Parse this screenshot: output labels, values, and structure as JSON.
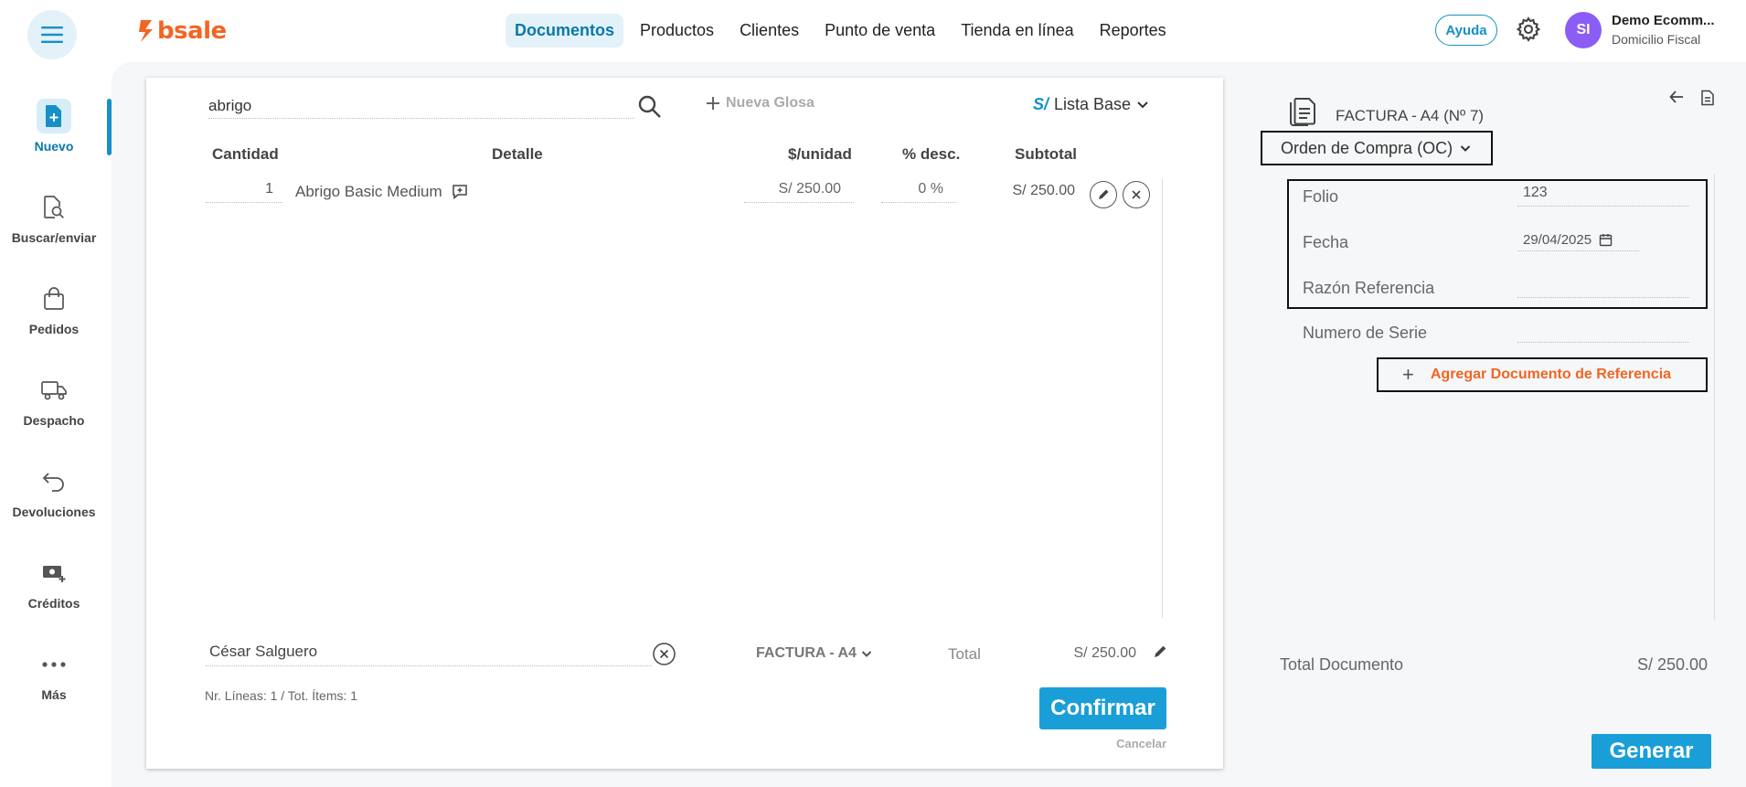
{
  "brand": {
    "logo_text": "bsale",
    "color": "#f26522"
  },
  "nav": {
    "items": [
      {
        "label": "Documentos",
        "active": true
      },
      {
        "label": "Productos"
      },
      {
        "label": "Clientes"
      },
      {
        "label": "Punto de venta"
      },
      {
        "label": "Tienda en línea"
      },
      {
        "label": "Reportes"
      }
    ],
    "help_label": "Ayuda",
    "avatar_initials": "SI",
    "account_name": "Demo Ecomm...",
    "account_subtitle": "Domicilio Fiscal"
  },
  "sidebar": {
    "items": [
      {
        "label": "Nuevo",
        "icon": "new-document-icon",
        "active": true
      },
      {
        "label": "Buscar/enviar",
        "icon": "search-document-icon"
      },
      {
        "label": "Pedidos",
        "icon": "shopping-bag-icon"
      },
      {
        "label": "Despacho",
        "icon": "truck-icon"
      },
      {
        "label": "Devoluciones",
        "icon": "return-arrow-icon"
      },
      {
        "label": "Créditos",
        "icon": "money-add-icon"
      },
      {
        "label": "Más",
        "icon": "more-dots-icon"
      }
    ]
  },
  "editor": {
    "search_value": "abrigo",
    "nueva_glosa": "Nueva Glosa",
    "price_list": {
      "currency": "S/",
      "label": "Lista Base"
    },
    "columns": {
      "cantidad": "Cantidad",
      "detalle": "Detalle",
      "unidad": "$/unidad",
      "desc": "% desc.",
      "subtotal": "Subtotal"
    },
    "line": {
      "qty": "1",
      "detail": "Abrigo Basic Medium",
      "unit_price": "S/ 250.00",
      "discount": "0 %",
      "subtotal": "S/ 250.00"
    },
    "client": "César Salguero",
    "doc_type": "FACTURA - A4",
    "total_label": "Total",
    "total_value": "S/ 250.00",
    "lines_info": "Nr. Líneas: 1 / Tot. Ítems: 1",
    "confirm_label": "Confirmar",
    "cancel_label": "Cancelar"
  },
  "right_panel": {
    "doc_title": "FACTURA - A4 (Nº 7)",
    "reference_type": "Orden de Compra (OC)",
    "fields": {
      "folio": {
        "label": "Folio",
        "value": "123"
      },
      "fecha": {
        "label": "Fecha",
        "value": "29/04/2025"
      },
      "razon": {
        "label": "Razón Referencia",
        "value": ""
      },
      "serie": {
        "label": "Numero de Serie",
        "value": ""
      }
    },
    "add_reference": "Agregar Documento de Referencia",
    "total_doc_label": "Total Documento",
    "total_doc_value": "S/ 250.00",
    "generate_label": "Generar"
  },
  "colors": {
    "accent": "#1690c7",
    "button": "#1a9ed8",
    "brand_orange": "#f26522"
  }
}
